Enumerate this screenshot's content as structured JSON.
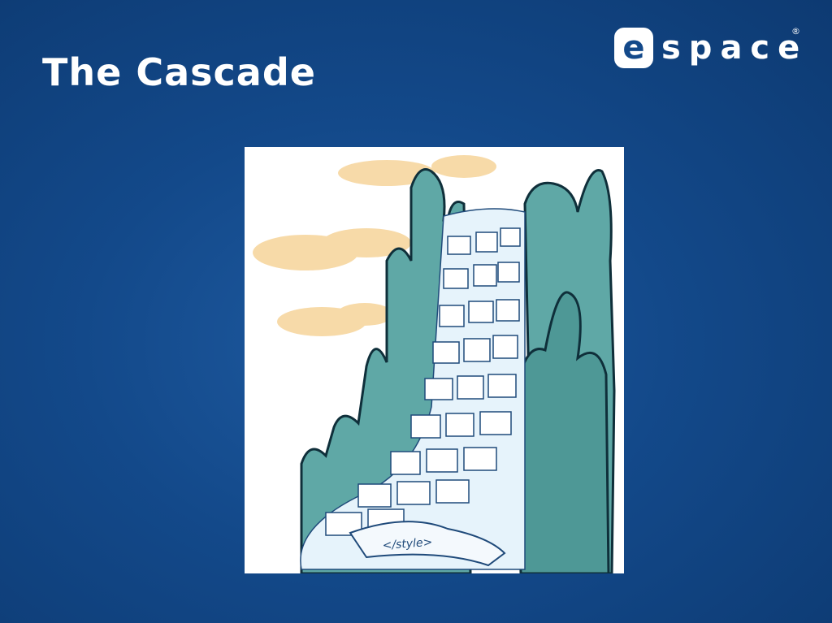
{
  "slide": {
    "title": "The Cascade"
  },
  "logo": {
    "mark": "e",
    "wordmark": "space",
    "registered": "®"
  },
  "illustration": {
    "label": "</style>"
  },
  "colors": {
    "background": "#13498a",
    "title": "#ffffff",
    "rock": "#5fa8a6",
    "cloud": "#f6d49a",
    "paper": "#ffffff"
  }
}
